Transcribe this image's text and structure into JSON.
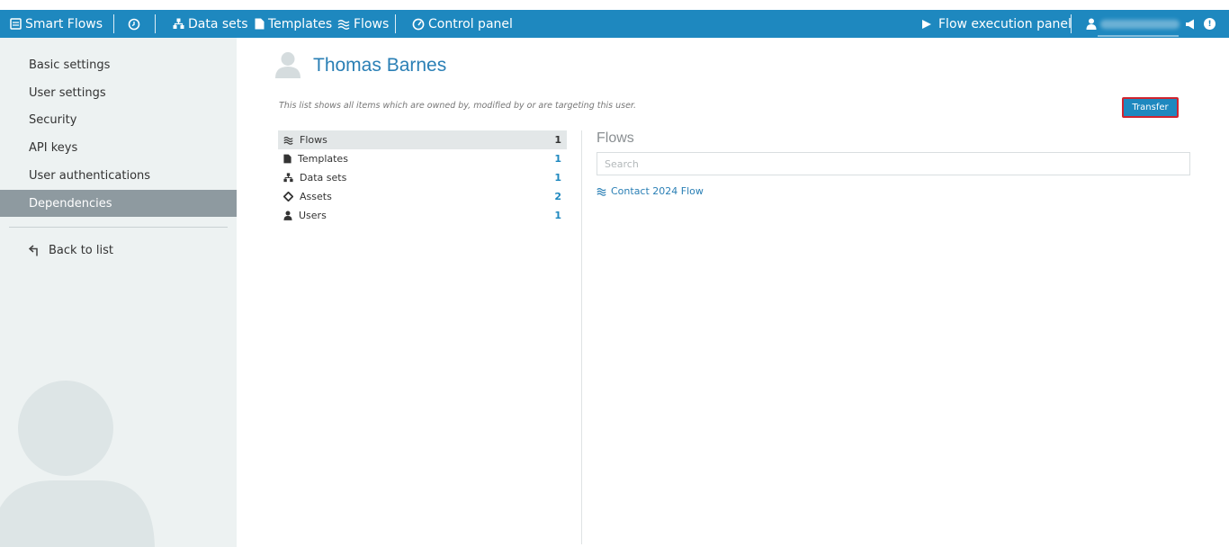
{
  "navbar": {
    "brand": "Smart Flows",
    "datasets": "Data sets",
    "templates": "Templates",
    "flows": "Flows",
    "control_panel": "Control panel",
    "flow_exec": "Flow execution panel",
    "notification_count": "!"
  },
  "sidebar": {
    "items": [
      {
        "label": "Basic settings"
      },
      {
        "label": "User settings"
      },
      {
        "label": "Security"
      },
      {
        "label": "API keys"
      },
      {
        "label": "User authentications"
      },
      {
        "label": "Dependencies"
      }
    ],
    "back": "Back to list"
  },
  "main": {
    "title": "Thomas Barnes",
    "info": "This list shows all items which are owned by, modified by or are targeting this user.",
    "transfer": "Transfer",
    "categories": [
      {
        "label": "Flows",
        "count": "1"
      },
      {
        "label": "Templates",
        "count": "1"
      },
      {
        "label": "Data sets",
        "count": "1"
      },
      {
        "label": "Assets",
        "count": "2"
      },
      {
        "label": "Users",
        "count": "1"
      }
    ],
    "panel_title": "Flows",
    "search_placeholder": "Search",
    "results": [
      {
        "label": "Contact 2024 Flow"
      }
    ]
  },
  "colors": {
    "navbar": "#1e88bf",
    "active_sidebar": "#8e9aa0",
    "link": "#2a7fb5",
    "transfer_border": "#d0242f"
  }
}
